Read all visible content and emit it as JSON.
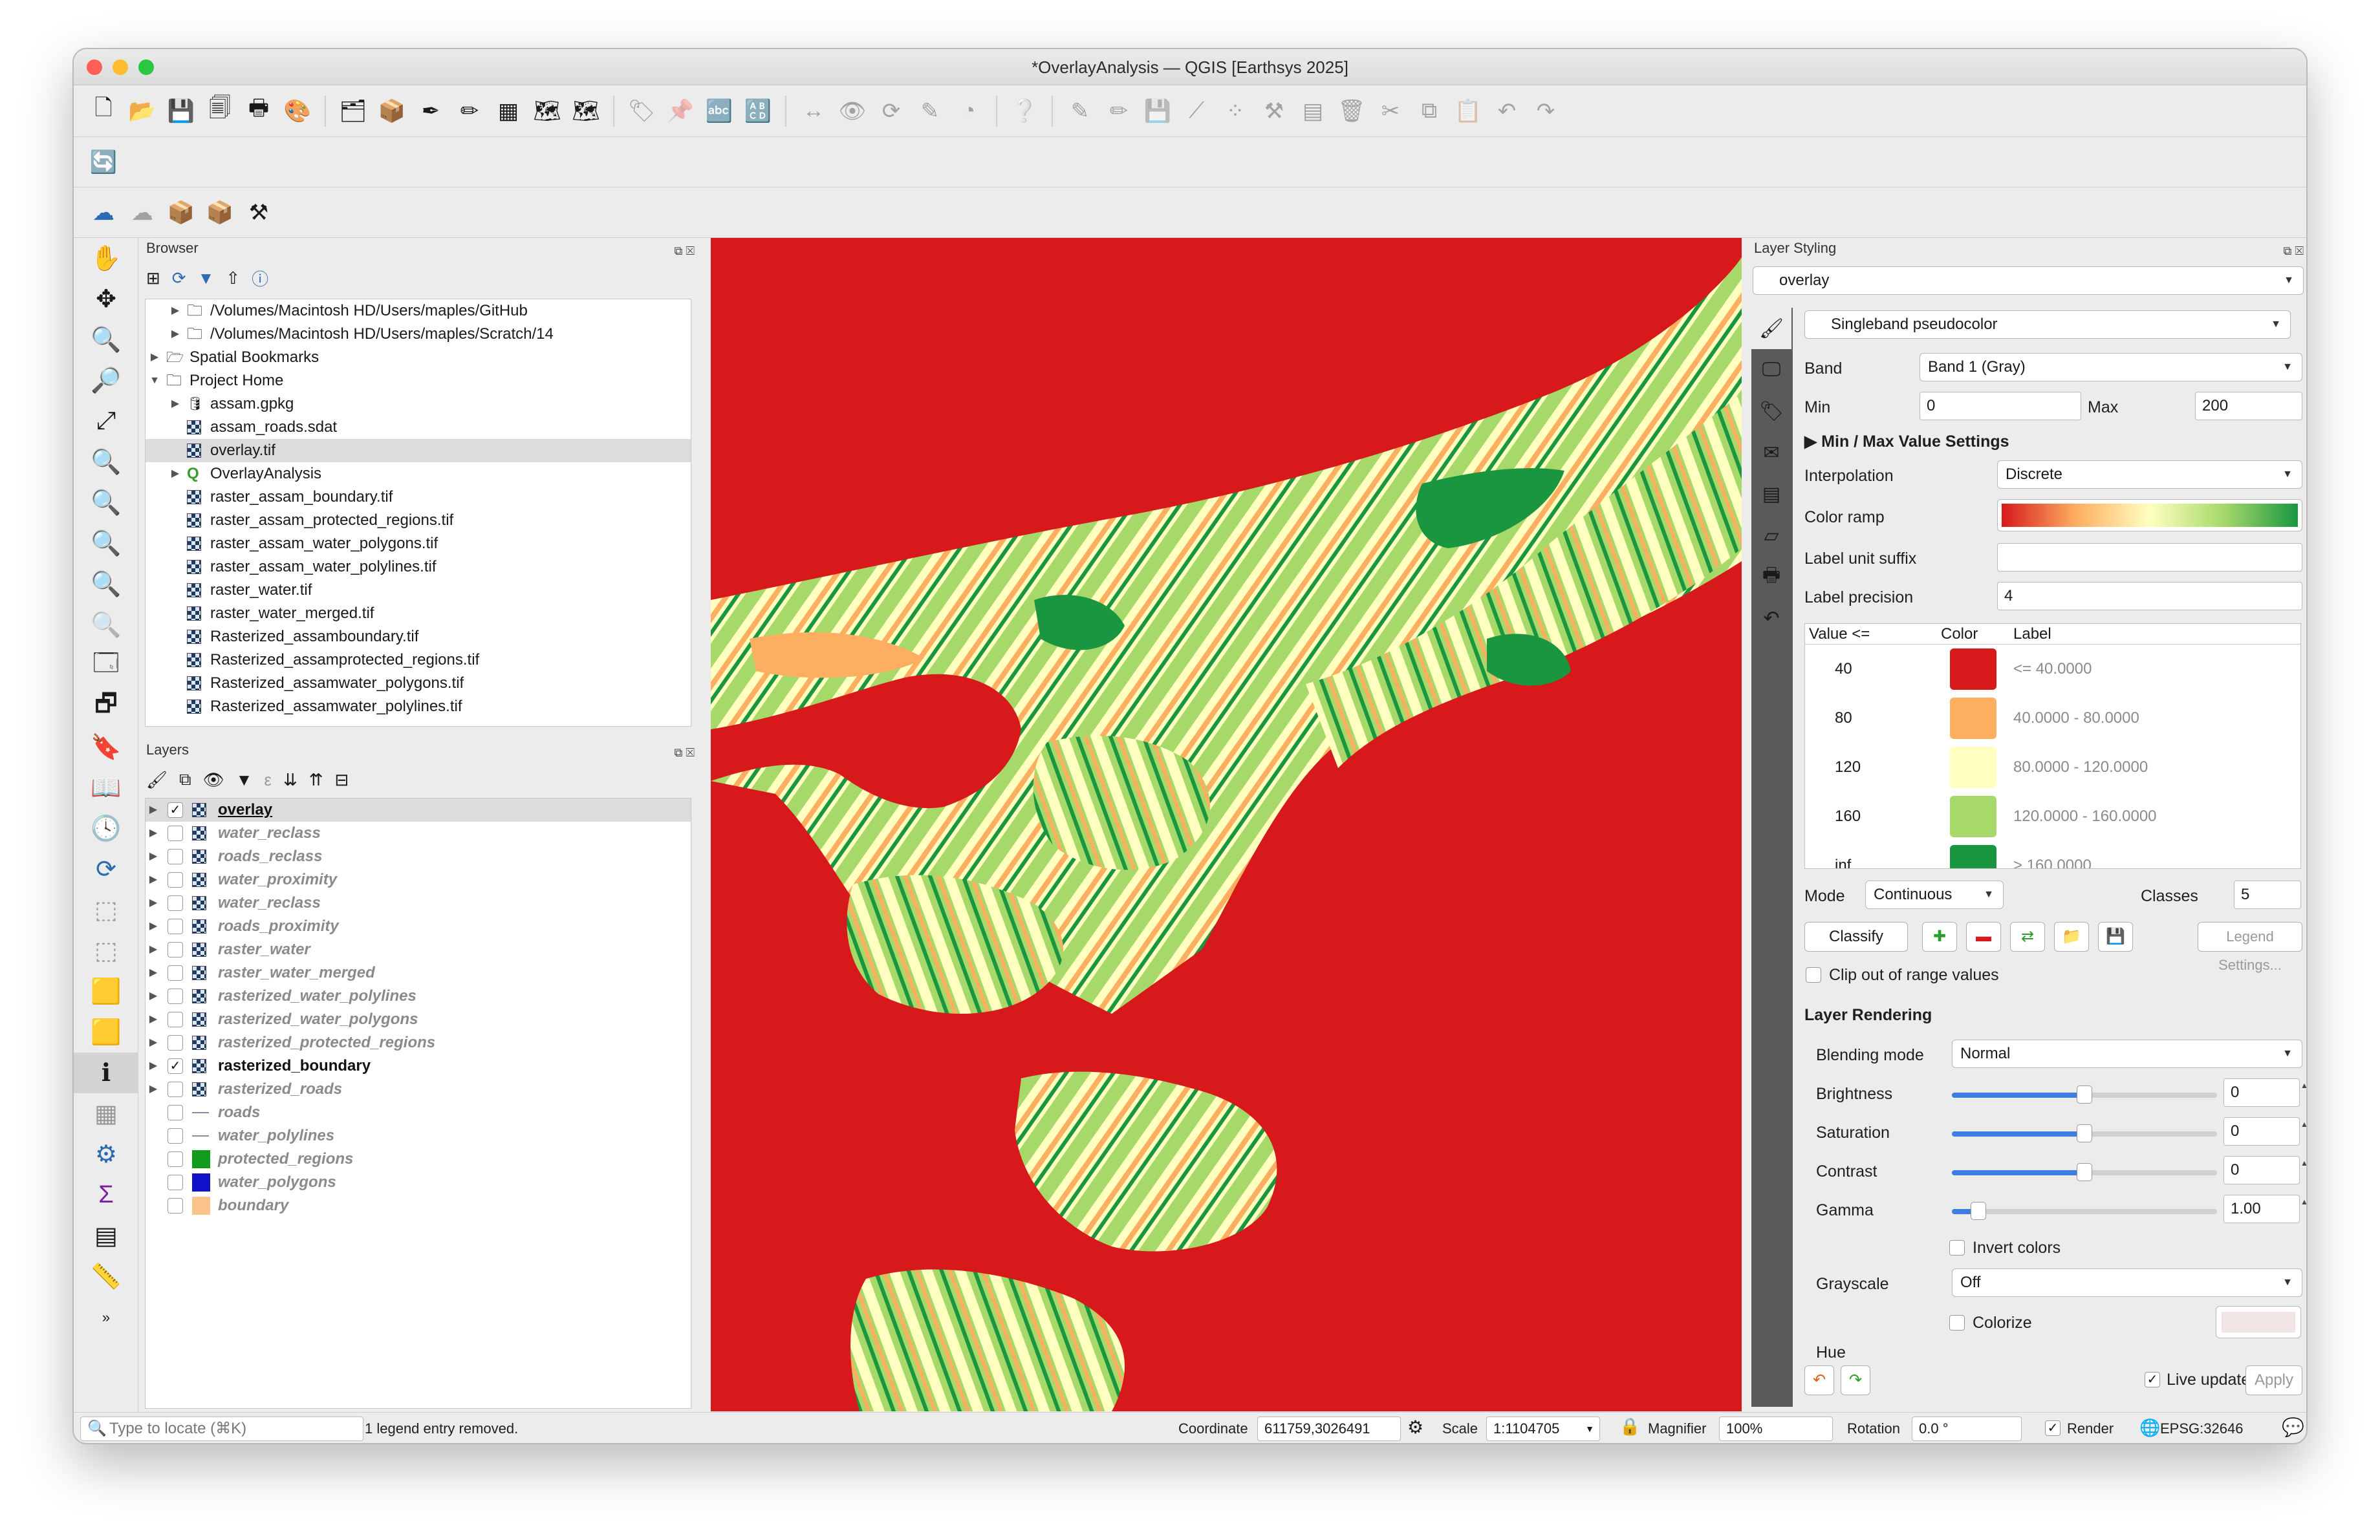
{
  "window": {
    "title": "*OverlayAnalysis — QGIS [Earthsys 2025]"
  },
  "browser": {
    "title": "Browser",
    "items": [
      {
        "label": "/Volumes/Macintosh HD/Users/maples/GitHub",
        "icon": "folder-icon"
      },
      {
        "label": "/Volumes/Macintosh HD/Users/maples/Scratch/14",
        "icon": "folder-icon"
      },
      {
        "label": "Spatial Bookmarks",
        "icon": "bookmark-icon"
      },
      {
        "label": "Project Home",
        "icon": "folder-icon"
      },
      {
        "label": "assam.gpkg",
        "icon": "database-icon"
      },
      {
        "label": "assam_roads.sdat",
        "icon": "raster-icon"
      },
      {
        "label": "overlay.tif",
        "icon": "raster-icon"
      },
      {
        "label": "OverlayAnalysis",
        "icon": "qgis-project-icon"
      },
      {
        "label": "raster_assam_boundary.tif",
        "icon": "raster-icon"
      },
      {
        "label": "raster_assam_protected_regions.tif",
        "icon": "raster-icon"
      },
      {
        "label": "raster_assam_water_polygons.tif",
        "icon": "raster-icon"
      },
      {
        "label": "raster_assam_water_polylines.tif",
        "icon": "raster-icon"
      },
      {
        "label": "raster_water.tif",
        "icon": "raster-icon"
      },
      {
        "label": "raster_water_merged.tif",
        "icon": "raster-icon"
      },
      {
        "label": "Rasterized_assamboundary.tif",
        "icon": "raster-icon"
      },
      {
        "label": "Rasterized_assamprotected_regions.tif",
        "icon": "raster-icon"
      },
      {
        "label": "Rasterized_assamwater_polygons.tif",
        "icon": "raster-icon"
      },
      {
        "label": "Rasterized_assamwater_polylines.tif",
        "icon": "raster-icon"
      }
    ]
  },
  "layers": {
    "title": "Layers",
    "items": [
      {
        "label": "overlay",
        "checked": true
      },
      {
        "label": "water_reclass",
        "checked": false
      },
      {
        "label": "roads_reclass",
        "checked": false
      },
      {
        "label": "water_proximity",
        "checked": false
      },
      {
        "label": "water_reclass",
        "checked": false
      },
      {
        "label": "roads_proximity",
        "checked": false
      },
      {
        "label": "raster_water",
        "checked": false
      },
      {
        "label": "raster_water_merged",
        "checked": false
      },
      {
        "label": "rasterized_water_polylines",
        "checked": false
      },
      {
        "label": "rasterized_water_polygons",
        "checked": false
      },
      {
        "label": "rasterized_protected_regions",
        "checked": false
      },
      {
        "label": "rasterized_boundary",
        "checked": true
      },
      {
        "label": "rasterized_roads",
        "checked": false
      },
      {
        "label": "roads",
        "checked": false
      },
      {
        "label": "water_polylines",
        "checked": false
      },
      {
        "label": "protected_regions",
        "checked": false
      },
      {
        "label": "water_polygons",
        "checked": false
      },
      {
        "label": "boundary",
        "checked": false
      }
    ]
  },
  "styling": {
    "title": "Layer Styling",
    "layer": "overlay",
    "renderer": "Singleband pseudocolor",
    "band_label": "Band",
    "band": "Band 1 (Gray)",
    "min_label": "Min",
    "min": "0",
    "max_label": "Max",
    "max": "200",
    "minmax_settings": "Min / Max Value Settings",
    "interpolation_label": "Interpolation",
    "interpolation": "Discrete",
    "color_ramp_label": "Color ramp",
    "label_unit_suffix_label": "Label unit suffix",
    "label_precision_label": "Label precision",
    "label_precision": "4",
    "table_headers": [
      "Value <=",
      "Color",
      "Label"
    ],
    "classes": [
      {
        "value": "40",
        "color": "#d7191c",
        "label": "<= 40.0000"
      },
      {
        "value": "80",
        "color": "#fdae61",
        "label": "40.0000 - 80.0000"
      },
      {
        "value": "120",
        "color": "#ffffbf",
        "label": "80.0000 - 120.0000"
      },
      {
        "value": "160",
        "color": "#a6d96a",
        "label": "120.0000 - 160.0000"
      },
      {
        "value": "inf",
        "color": "#1a9641",
        "label": "> 160.0000"
      }
    ],
    "mode_label": "Mode",
    "mode": "Continuous",
    "classes_label": "Classes",
    "classes_count": "5",
    "classify": "Classify",
    "legend_settings": "Legend Settings...",
    "clip_label": "Clip out of range values",
    "rendering_title": "Layer Rendering",
    "blending_label": "Blending mode",
    "blending": "Normal",
    "brightness_label": "Brightness",
    "brightness": "0",
    "brightness_level": 0.5,
    "saturation_label": "Saturation",
    "saturation": "0",
    "saturation_level": 0.5,
    "contrast_label": "Contrast",
    "contrast": "0",
    "contrast_level": 0.5,
    "gamma_label": "Gamma",
    "gamma": "1.00",
    "gamma_level": 0.1,
    "invert_label": "Invert colors",
    "grayscale_label": "Grayscale",
    "grayscale": "Off",
    "colorize_label": "Colorize",
    "hue_label": "Hue",
    "live_update": "Live update",
    "apply": "Apply"
  },
  "status": {
    "locate_placeholder": "Type to locate (⌘K)",
    "message": "1 legend entry removed.",
    "coordinate_label": "Coordinate",
    "coordinate": "611759,3026491",
    "scale_label": "Scale",
    "scale": "1:1104705",
    "magnifier_label": "Magnifier",
    "magnifier": "100%",
    "rotation_label": "Rotation",
    "rotation": "0.0 °",
    "render_label": "Render",
    "crs": "EPSG:32646"
  },
  "colors": {
    "class1": "#d7191c",
    "class2": "#fdae61",
    "class3": "#ffffbf",
    "class4": "#a6d96a",
    "class5": "#1a9641",
    "accent": "#3d7ee0"
  }
}
